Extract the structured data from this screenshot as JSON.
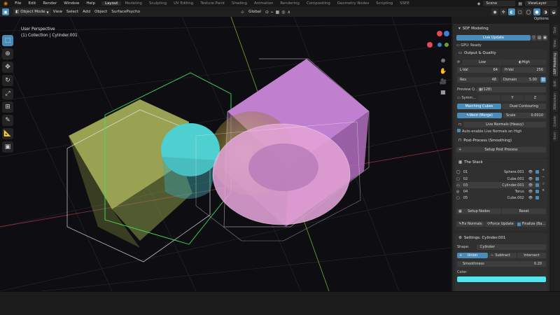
{
  "topbar": {
    "menus": [
      "File",
      "Edit",
      "Render",
      "Window",
      "Help"
    ],
    "workspaces": [
      "Layout",
      "Modeling",
      "Sculpting",
      "UV Editing",
      "Texture Paint",
      "Shading",
      "Animation",
      "Rendering",
      "Compositing",
      "Geometry Nodes",
      "Scripting",
      "SSEE"
    ],
    "scene": "Scene",
    "view_layer": "ViewLayer"
  },
  "header": {
    "mode": "Object Mode",
    "menus": [
      "View",
      "Select",
      "Add",
      "Object",
      "SurfacePsycho"
    ],
    "orientation": "Global",
    "options": "Options"
  },
  "viewport": {
    "perspective": "User Perspective",
    "collection": "(1) Collection | Cylinder.001"
  },
  "panel": {
    "title": "SDF Modeling",
    "live_update": "Live Update",
    "gpu": "GPU: Ready",
    "output": {
      "title": "Output & Quality",
      "low": "Low",
      "high": "High",
      "lval_label": "L-Val",
      "lval": "64",
      "hval_label": "H-Val",
      "hval": "256",
      "res_label": "Res",
      "res": "48",
      "domain_label": "Domain",
      "domain": "5.00",
      "preview_label": "Preview Q...",
      "preview_val": "(128)",
      "symm_label": "Symm...",
      "symm_y": "Y",
      "symm_z": "Z",
      "mesh_a": "Marching Cubes",
      "mesh_b": "Dual Contouring",
      "weld": "Weld (Merge)",
      "scale_label": "Scale",
      "scale": "0.0010",
      "live_normals": "Live Normals (Heavy)",
      "auto_normals": "Auto-enable Live Normals on High"
    },
    "post": {
      "title": "Post-Process (Smoothing)",
      "setup": "Setup Post Process"
    },
    "stack": {
      "title": "The Stack",
      "items": [
        {
          "num": "01",
          "name": "Sphere.001"
        },
        {
          "num": "02",
          "name": "Cube.001"
        },
        {
          "num": "03",
          "name": "Cylinder.001"
        },
        {
          "num": "04",
          "name": "Torus"
        },
        {
          "num": "05",
          "name": "Cube.002"
        }
      ],
      "setup_nodes": "Setup Nodes",
      "reset": "Reset",
      "fix_normals": "Fix Normals",
      "force_update": "Force Update",
      "finalize": "Finalize (Ba..."
    },
    "settings": {
      "title": "Settings: Cylinder.001",
      "shape_label": "Shape:",
      "shape": "Cylinder",
      "ops": [
        "Union",
        "Subtract",
        "Intersect"
      ],
      "smoothness_label": "Smoothness",
      "smoothness": "0.20",
      "color_label": "Color:",
      "color": "#4fe6ee"
    }
  },
  "vtabs": [
    "Tool",
    "View",
    "SDF Modeling",
    "Edit",
    "3DBoolean",
    "Create",
    "Item"
  ]
}
